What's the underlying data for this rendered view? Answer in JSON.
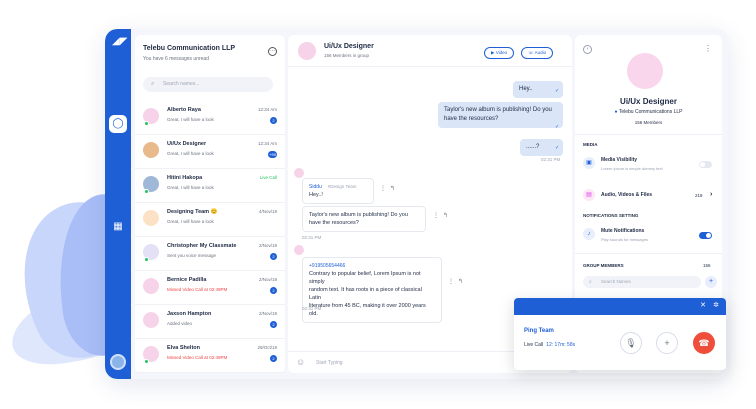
{
  "contacts": {
    "title": "Telebu Communication LLP",
    "subtitle": "You have 6 messages unread",
    "search_placeholder": "Search names...",
    "items": [
      {
        "name": "Alberto Raya",
        "message": "Great, I will have a look",
        "time": "12:34 Am",
        "badge": "2"
      },
      {
        "name": "Ui/Ux Designer",
        "message": "Great, I will have a look",
        "time": "12:34 Am",
        "badge": "+99"
      },
      {
        "name": "Hitini Hakopa",
        "message": "Great, I will have a look",
        "time": "Live Call",
        "badge": ""
      },
      {
        "name": "Designing Team 😊",
        "message": "Great, I will have a look",
        "time": "4/Nov/19",
        "badge": ""
      },
      {
        "name": "Christopher My Classmate",
        "message": "Sent you voice message",
        "time": "2/Nov/19",
        "badge": "2"
      },
      {
        "name": "Bernice Padilla",
        "message": "Missed Video Call at 02:49PM",
        "time": "2/Nov/19",
        "badge": "2"
      },
      {
        "name": "Jaxson Hampton",
        "message": "Added video",
        "time": "2/Nov/19",
        "badge": "2"
      },
      {
        "name": "Elva Shelton",
        "message": "Missed Video Call at 02:49PM",
        "time": "29/Oct/19",
        "badge": "2"
      }
    ]
  },
  "chat": {
    "title": "Ui/Ux Designer",
    "subtitle": "156 Members in group",
    "video_label": "Video",
    "audio_label": "Audio",
    "out1": "Hey..",
    "out2_line1": "Taylor's new album is publishing! Do you",
    "out2_line2": "have the resources?",
    "out3": "......?",
    "out_time": "02:31 PM",
    "reply_name": "Siddu",
    "reply_tag": "#Design Team",
    "reply_text": "Hey..!",
    "in1_line1": "Taylor's new album is publishing! Do you",
    "in1_line2": "have the resources?",
    "in1_time": "02:31 PM",
    "phone": "+919505654466",
    "in2_line1": "Contrary to popular belief, Lorem Ipsum is not simply",
    "in2_line2": "random text. It has roots in a piece of classical Latin",
    "in2_line3": "literature from 45 BC, making it over 2000 years old.",
    "in2_time": "02:31 PM",
    "input_placeholder": "Start Typing"
  },
  "info": {
    "name": "Ui/Ux Designer",
    "org": "Telebu Communications LLP",
    "members": "156 Members",
    "media_section": "MEDIA",
    "media_visibility": "Media Visibility",
    "media_visibility_sub": "Lorem ipsum is simple dummy text",
    "audio_files": "Audio, Videos & Files",
    "audio_count": "218",
    "notif_section": "NOTIFICATIONS SETTING",
    "mute": "Mute Notifications",
    "mute_sub": "Play sounds for messages",
    "group_section": "GROUP MEMBERS",
    "group_count": "156",
    "search_placeholder": "Search Names"
  },
  "call": {
    "team": "Ping Team",
    "live_label": "Live Call",
    "duration": "12: 17m: 58s"
  },
  "colors": {
    "accent": "#1f5fd6",
    "end_call": "#ef4e3a",
    "live_green": "#22c55e"
  }
}
